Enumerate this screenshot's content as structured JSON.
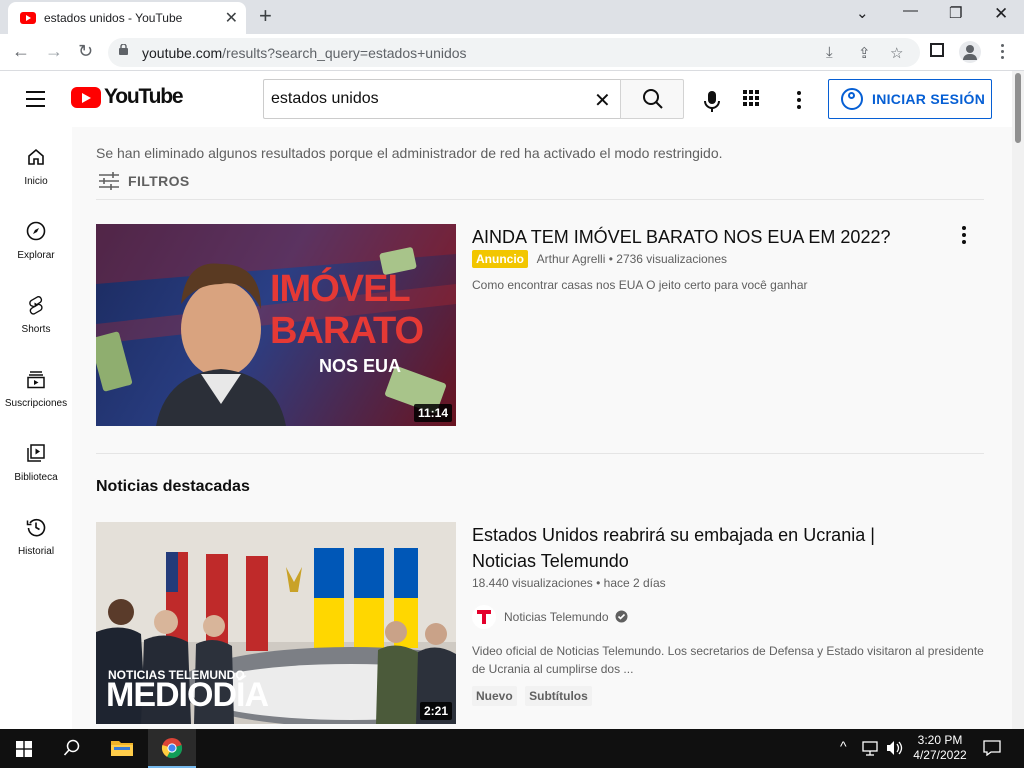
{
  "browser": {
    "tab_title": "estados unidos - YouTube",
    "url_host": "youtube.com",
    "url_path": "/results?search_query=estados+unidos"
  },
  "masthead": {
    "logo_text": "YouTube",
    "search_value": "estados unidos",
    "sign_in_label": "INICIAR SESIÓN"
  },
  "guide": {
    "items": [
      {
        "label": "Inicio",
        "icon": "home-icon"
      },
      {
        "label": "Explorar",
        "icon": "compass-icon"
      },
      {
        "label": "Shorts",
        "icon": "shorts-icon"
      },
      {
        "label": "Suscripciones",
        "icon": "subscriptions-icon"
      },
      {
        "label": "Biblioteca",
        "icon": "library-icon"
      },
      {
        "label": "Historial",
        "icon": "history-icon"
      }
    ]
  },
  "results": {
    "notice": "Se han eliminado algunos resultados porque el administrador de red ha activado el modo restringido.",
    "filters_label": "FILTROS",
    "ad": {
      "title": "AINDA TEM IMÓVEL BARATO NOS EUA EM 2022?",
      "badge": "Anuncio",
      "channel": "Arthur Agrelli",
      "views": "2736 visualizaciones",
      "description": "Como encontrar casas nos EUA O jeito certo para você ganhar",
      "duration": "11:14",
      "thumb_line1": "IMÓVEL",
      "thumb_line2": "BARATO",
      "thumb_line3": "NOS EUA"
    },
    "shelf_title": "Noticias destacadas",
    "video": {
      "title_line1": "Estados Unidos reabrirá su embajada en Ucrania |",
      "title_line2": "Noticias Telemundo",
      "views": "18.440 visualizaciones",
      "age": "hace 2 días",
      "channel": "Noticias Telemundo",
      "description_line1": "Video oficial de Noticias Telemundo. Los secretarios de Defensa y Estado visitaron al presidente",
      "description_line2": "de Ucrania al cumplirse dos ...",
      "chips": [
        "Nuevo",
        "Subtítulos"
      ],
      "duration": "2:21",
      "thumb_brand": "NOTICIAS TELEMUNDO",
      "thumb_show": "MEDIODÍA"
    }
  },
  "taskbar": {
    "time": "3:20 PM",
    "date": "4/27/2022"
  },
  "colors": {
    "yt_red": "#ff0000",
    "link_blue": "#065fd4",
    "ad_yellow": "#f2c600"
  }
}
